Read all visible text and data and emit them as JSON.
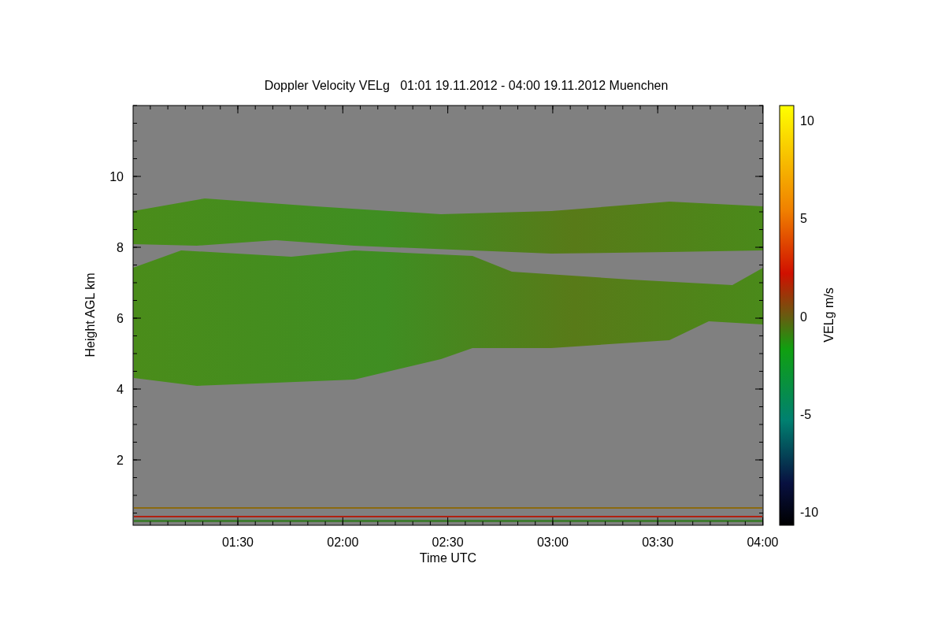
{
  "title": "Doppler Velocity VELg   01:01 19.11.2012 - 04:00 19.11.2012 Muenchen",
  "y_axis": {
    "label": "Height AGL km",
    "ticks": [
      "10",
      "8",
      "6",
      "4",
      "2"
    ]
  },
  "x_axis": {
    "label": "Time UTC",
    "ticks": [
      "01:30",
      "02:00",
      "02:30",
      "03:00",
      "03:30",
      "04:00"
    ]
  },
  "colorbar": {
    "label": "VELg m/s",
    "ticks": [
      "10",
      "5",
      "0",
      "-5",
      "-10"
    ]
  }
}
